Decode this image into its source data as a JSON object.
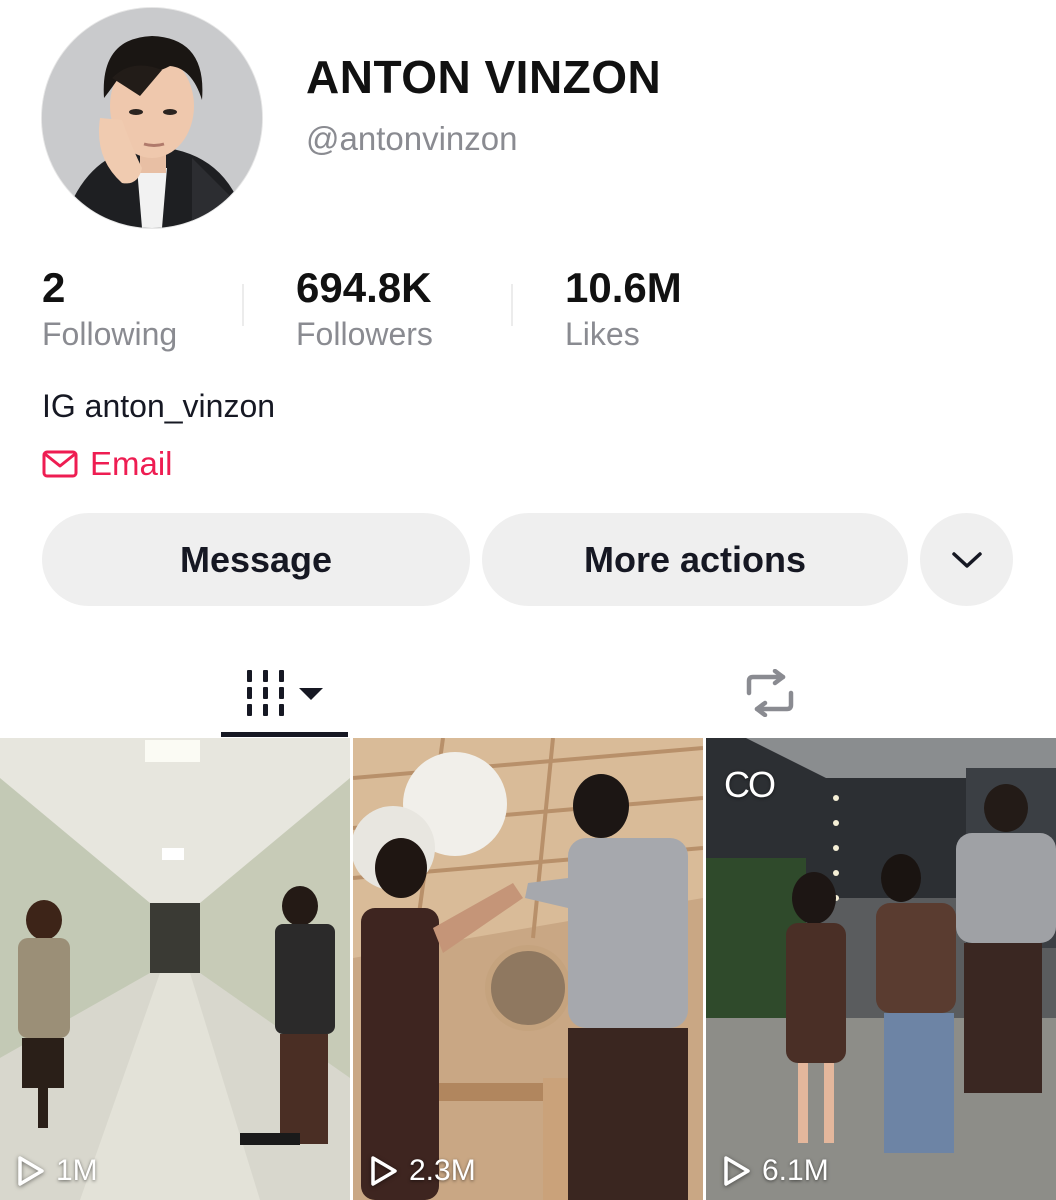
{
  "profile": {
    "name": "ANTON VINZON",
    "handle": "@antonvinzon",
    "avatar_icon": "profile-photo"
  },
  "stats": {
    "following": {
      "value": "2",
      "label": "Following"
    },
    "followers": {
      "value": "694.8K",
      "label": "Followers"
    },
    "likes": {
      "value": "10.6M",
      "label": "Likes"
    }
  },
  "bio": {
    "text": "IG anton_vinzon",
    "email_label": "Email",
    "email_icon": "mail-icon"
  },
  "actions": {
    "message_label": "Message",
    "more_actions_label": "More actions",
    "chevron_icon": "chevron-down-icon"
  },
  "tabs": {
    "videos_icon": "grid-icon",
    "reposts_icon": "repost-icon",
    "active": "videos"
  },
  "videos": [
    {
      "views": "1M"
    },
    {
      "views": "2.3M"
    },
    {
      "views": "6.1M",
      "badge": "CO"
    }
  ],
  "colors": {
    "accent_red": "#ee1d52",
    "text_primary": "#161823",
    "text_secondary": "#8a8b91",
    "button_bg": "#efefef"
  }
}
